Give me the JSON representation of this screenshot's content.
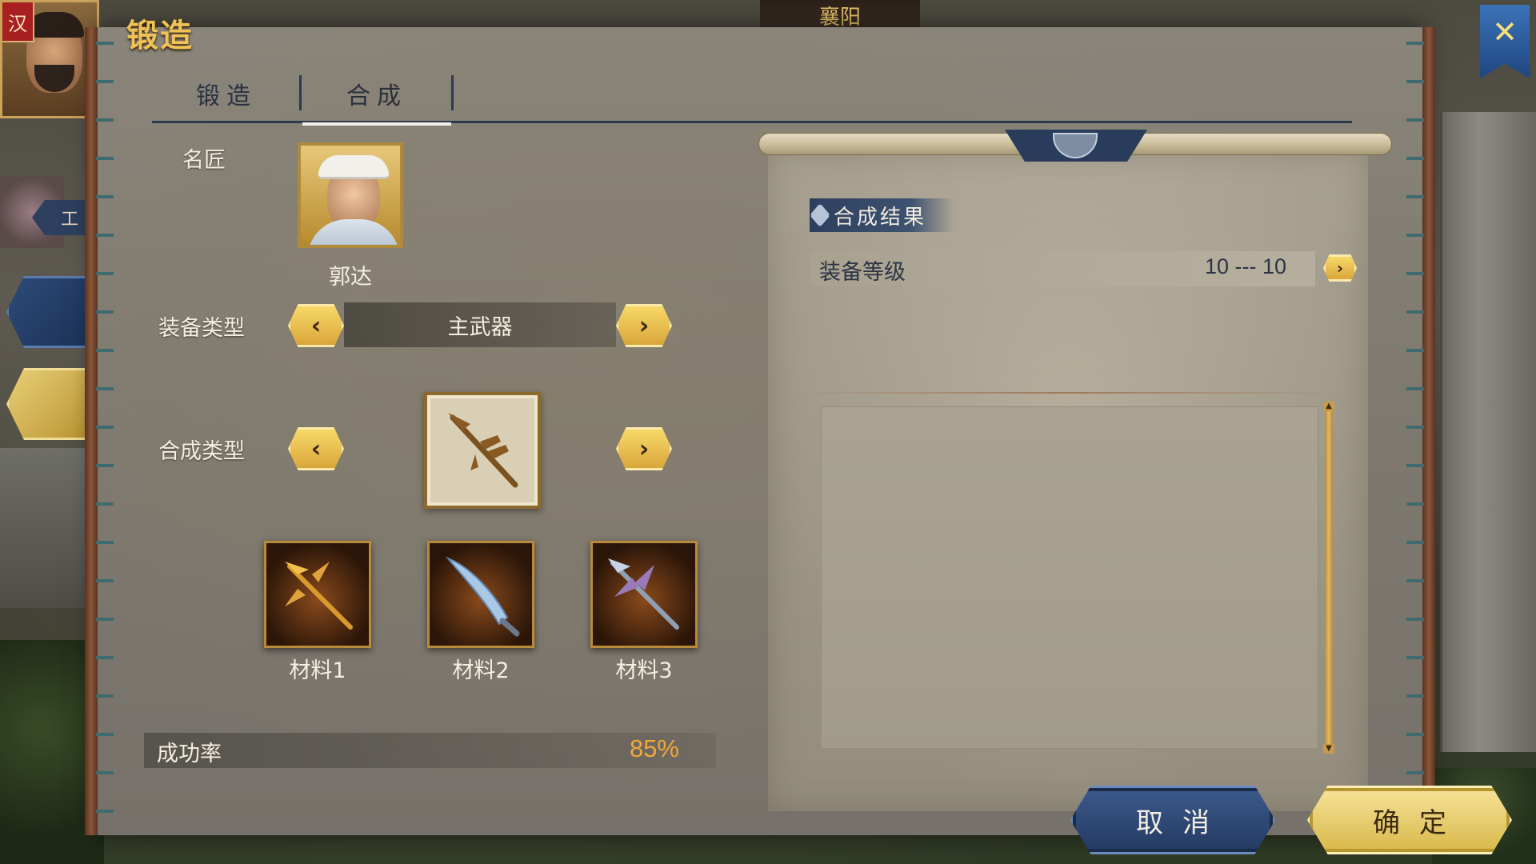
{
  "hud": {
    "faction": "汉",
    "city": "襄阳",
    "left_tag": "工",
    "quick_icon": "crossed-tools-icon"
  },
  "panel": {
    "title": "锻造",
    "tabs": [
      {
        "label": "锻造",
        "active": false
      },
      {
        "label": "合成",
        "active": true
      }
    ]
  },
  "form": {
    "smith_label": "名匠",
    "smith_name": "郭达",
    "equip_type_label": "装备类型",
    "equip_type_value": "主武器",
    "synth_type_label": "合成类型",
    "synth_type_icon": "halberd-icon",
    "materials": [
      {
        "label": "材料1",
        "icon": "golden-trident-icon"
      },
      {
        "label": "材料2",
        "icon": "blue-glaive-icon"
      },
      {
        "label": "材料3",
        "icon": "winged-spear-icon"
      }
    ],
    "success_label": "成功率",
    "success_value": "85%"
  },
  "result": {
    "title": "合成结果",
    "level_label": "装备等级",
    "level_value": "10 --- 10"
  },
  "buttons": {
    "cancel": "取消",
    "confirm": "确定"
  },
  "colors": {
    "accent_gold": "#f0c256",
    "navy": "#2c3f5e",
    "rate_orange": "#f0a83a"
  }
}
